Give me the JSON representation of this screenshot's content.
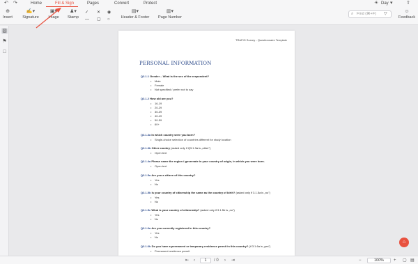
{
  "tabs": {
    "home": "Home",
    "fill_sign": "Fill & Sign",
    "pages": "Pages",
    "convert": "Convert",
    "protect": "Protect"
  },
  "theme_label": "Day",
  "toolbar": {
    "insert": "Insert",
    "signature": "Signature",
    "image": "Image",
    "stamp": "Stamp",
    "header_footer": "Header & Footer",
    "page_number": "Page Number",
    "feedback": "Feedback",
    "find_placeholder": "Find (⌘+F)"
  },
  "document": {
    "header": "TRAFIG Survey - Questionnaire Template",
    "title": "PERSONAL INFORMATION",
    "questions": [
      {
        "code": "Q3.1.1",
        "text": "Gender – What is the sex of the respondent?",
        "note": "",
        "options": [
          "Male",
          "Female",
          "Not specified / prefer not to say"
        ]
      },
      {
        "code": "Q3.1.2",
        "text": "How old are you?",
        "note": "",
        "options": [
          "16-19",
          "20-29",
          "30-39",
          "40-49",
          "50-59",
          "60+"
        ]
      },
      {
        "code": "Q3.1.3a",
        "text": "In which country were you born?",
        "note": "",
        "options": [
          "Single-choice selection of countries different for study location"
        ]
      },
      {
        "code": "Q3.1.3b",
        "text": "Other country",
        "note": " (asked only if Q3.1.3a is „other\")",
        "options": [
          "Open text"
        ]
      },
      {
        "code": "Q3.1.4a",
        "text": "Please name the region /-governate in your country of origin, in which you were born.",
        "note": "",
        "options": [
          "Open text"
        ]
      },
      {
        "code": "Q3.1.5a",
        "text": "Are you a citizen of this country?",
        "note": "",
        "options": [
          "Yes",
          "No"
        ]
      },
      {
        "code": "Q3.1.5b",
        "text": "Is your country of citizenship the same as the country of birth?",
        "note": " (asked only if 3.1.5a is „no\")",
        "options": [
          "Yes",
          "No"
        ]
      },
      {
        "code": "Q3.1.5c",
        "text": "What is your country of citizenship?",
        "note": " (asked only if 3.1.5b is „no\")",
        "options": [
          "Yes",
          "No"
        ]
      },
      {
        "code": "Q3.1.6a",
        "text": "Are you currently registered in this country?",
        "note": "",
        "options": [
          "Yes",
          "No"
        ]
      },
      {
        "code": "Q3.1.6b",
        "text": "Do you have a permanent or temporary residence permit in this country?",
        "note": " (if 3.1.6a is „yes\")",
        "options": [
          "Permanent residence permit"
        ]
      }
    ]
  },
  "pagination": {
    "current": "1",
    "total": "/ 0"
  },
  "zoom_value": "100%",
  "accent_color": "#e8513f"
}
